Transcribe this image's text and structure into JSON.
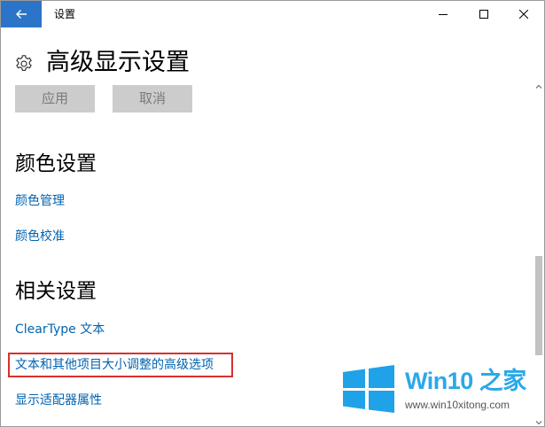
{
  "window": {
    "title": "设置"
  },
  "page": {
    "title": "高级显示设置"
  },
  "buttons": {
    "apply": "应用",
    "cancel": "取消"
  },
  "sections": {
    "color": {
      "heading": "颜色设置",
      "links": [
        "颜色管理",
        "颜色校准"
      ]
    },
    "related": {
      "heading": "相关设置",
      "links": [
        "ClearType 文本",
        "文本和其他项目大小调整的高级选项",
        "显示适配器属性"
      ]
    }
  },
  "watermark": {
    "logo_text": "Win10 之家",
    "url": "www.win10xitong.com"
  },
  "colors": {
    "accent": "#2b74c7",
    "link": "#0063b1",
    "highlight": "#d9302c",
    "watermark": "#2aa8e8"
  }
}
